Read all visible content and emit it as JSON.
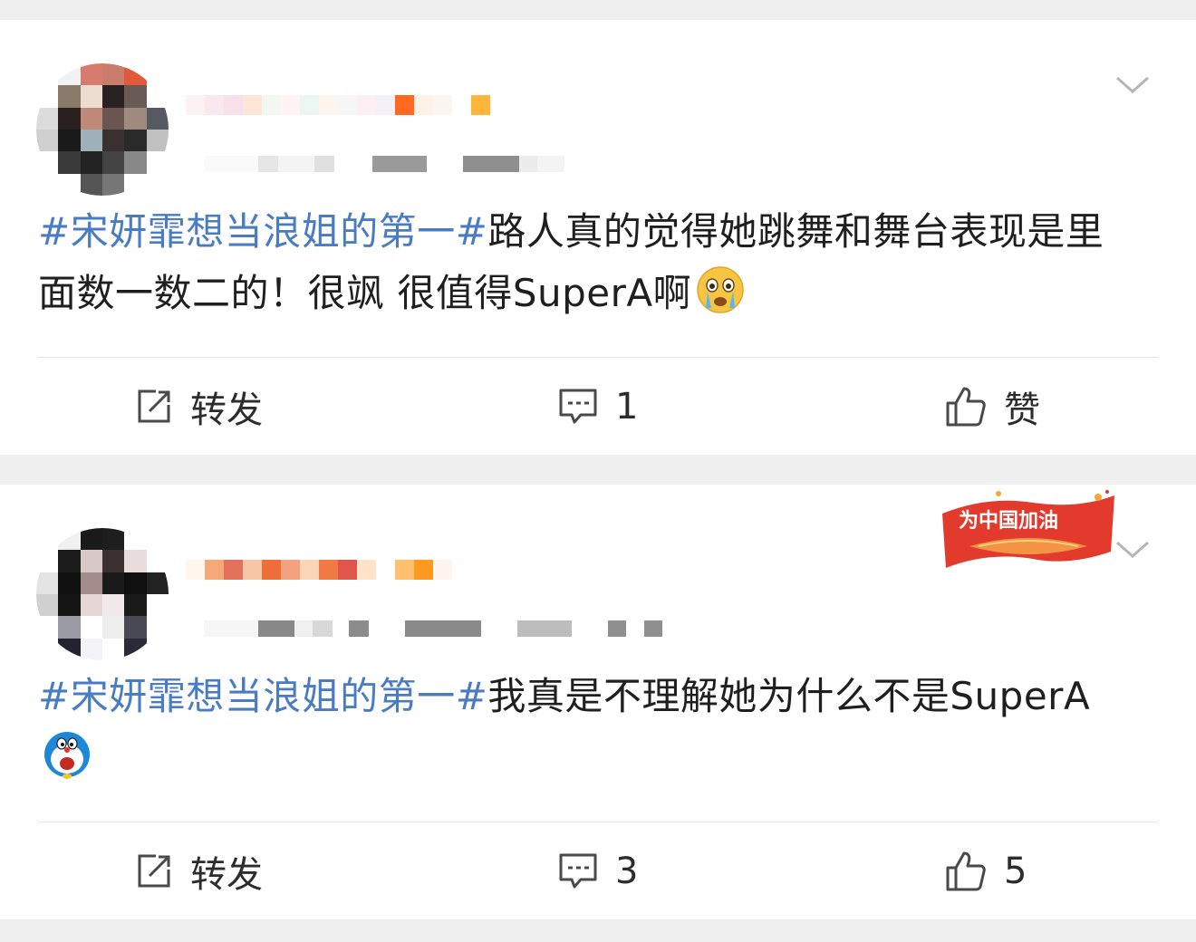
{
  "posts": [
    {
      "tag": "#宋妍霏想当浪姐的第一#",
      "text": "路人真的觉得她跳舞和舞台表现是里面数一数二的！很飒 很值得SuperA啊",
      "emoji": "crying-face",
      "actions": {
        "repost": "转发",
        "comment": "1",
        "like": "赞"
      }
    },
    {
      "tag": "#宋妍霏想当浪姐的第一#",
      "text": "我真是不理解她为什么不是SuperA",
      "emoji": "doraemon-face",
      "badge": "为中国加油",
      "actions": {
        "repost": "转发",
        "comment": "3",
        "like": "5"
      }
    }
  ],
  "colors": {
    "tag": "#4a7cc4",
    "background": "#efefef",
    "card": "#ffffff",
    "badge": "#e23b2e"
  }
}
